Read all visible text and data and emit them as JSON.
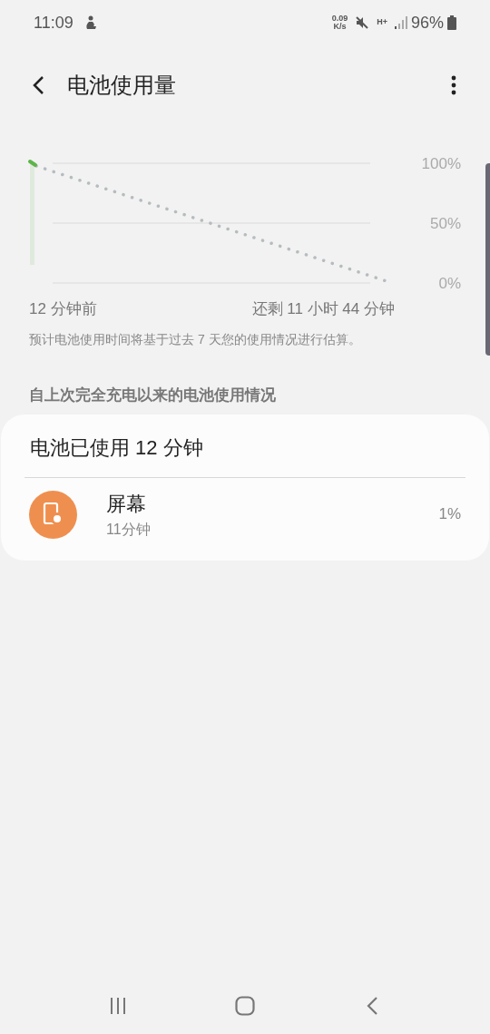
{
  "status_bar": {
    "time": "11:09",
    "speed_value": "0.09",
    "speed_unit": "K/s",
    "network": "H+",
    "battery": "96%"
  },
  "header": {
    "title": "电池使用量"
  },
  "chart": {
    "y_labels": [
      "100%",
      "50%",
      "0%"
    ],
    "start_label": "12 分钟前",
    "end_label": "还剩 11 小时 44 分钟"
  },
  "note": "预计电池使用时间将基于过去 7 天您的使用情况进行估算。",
  "section_title": "自上次完全充电以来的电池使用情况",
  "card": {
    "title": "电池已使用 12 分钟",
    "items": [
      {
        "name": "屏幕",
        "time": "11分钟",
        "percent": "1%",
        "color": "#ef8f4f"
      }
    ]
  }
}
